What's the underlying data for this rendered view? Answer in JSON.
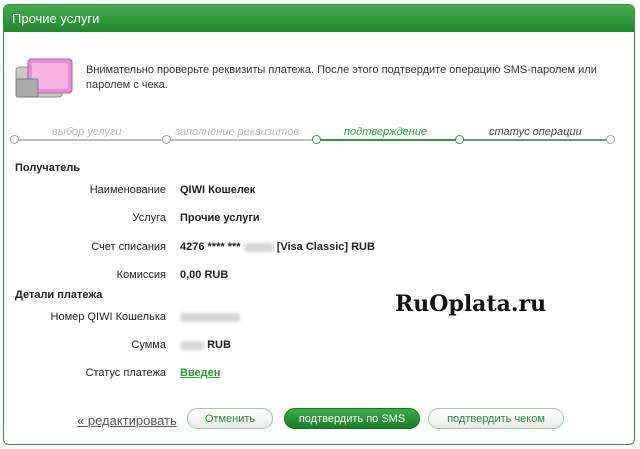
{
  "window": {
    "title": "Прочие услуги"
  },
  "intro": {
    "icon": "wallet-icon",
    "text": "Внимательно проверьте реквизиты платежа. После этого подтвердите операцию SMS-паролем или паролем с чека."
  },
  "steps": [
    {
      "label": "выбор услуги",
      "state": "done"
    },
    {
      "label": "заполнение реквизитов",
      "state": "done"
    },
    {
      "label": "подтверждение",
      "state": "active"
    },
    {
      "label": "статус операции",
      "state": "next"
    }
  ],
  "recipient": {
    "heading": "Получатель",
    "rows": [
      {
        "label": "Наименование",
        "value": "QIWI Кошелек"
      },
      {
        "label": "Услуга",
        "value": "Прочие услуги"
      },
      {
        "label": "Счет списания",
        "value_prefix": "4276 **** ***",
        "value_suffix": "[Visa Classic]  RUB"
      },
      {
        "label": "Комиссия",
        "value": "0,00 RUB"
      }
    ]
  },
  "details": {
    "heading": "Детали платежа",
    "wallet_label": "Номер QIWI Кошелька",
    "sum_label": "Сумма",
    "sum_currency": "RUB",
    "status_label": "Статус платежа",
    "status_value": "Введен"
  },
  "watermark": "RuOplata.ru",
  "actions": {
    "edit": "« редактировать",
    "cancel": "Отменить",
    "confirm_sms": "подтвердить по SMS",
    "confirm_check": "подтвердить чеком"
  },
  "colors": {
    "brand_green": "#2a9a36",
    "title_bar": "#1f8a2c"
  }
}
